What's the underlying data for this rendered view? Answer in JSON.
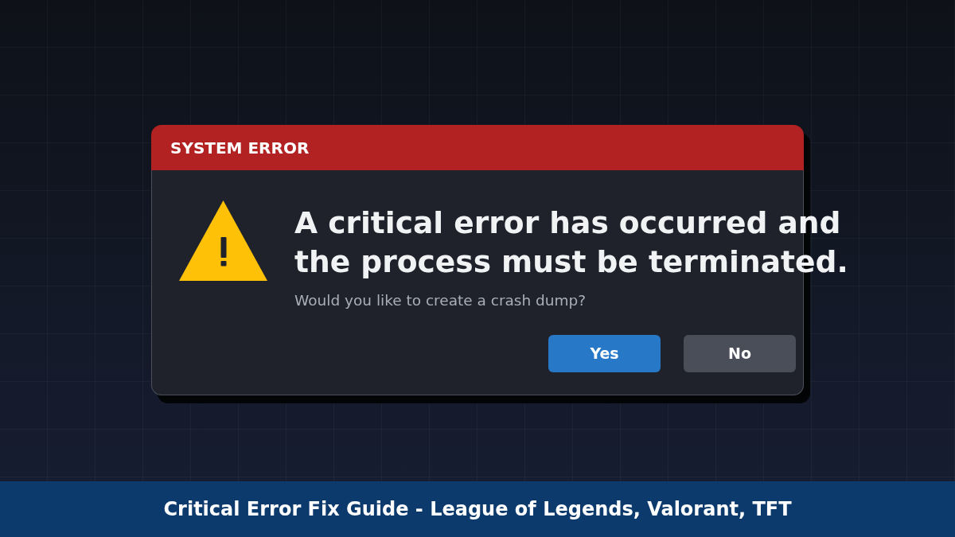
{
  "dialog": {
    "title": "SYSTEM ERROR",
    "heading": "A critical error has occurred and the process must be terminated.",
    "message": "Would you like to create a crash dump?",
    "buttons": [
      {
        "label": "Yes",
        "kind": "primary"
      },
      {
        "label": "No",
        "kind": "secondary"
      }
    ]
  },
  "banner": {
    "text": "Critical Error Fix Guide - League of Legends, Valorant, TFT"
  }
}
